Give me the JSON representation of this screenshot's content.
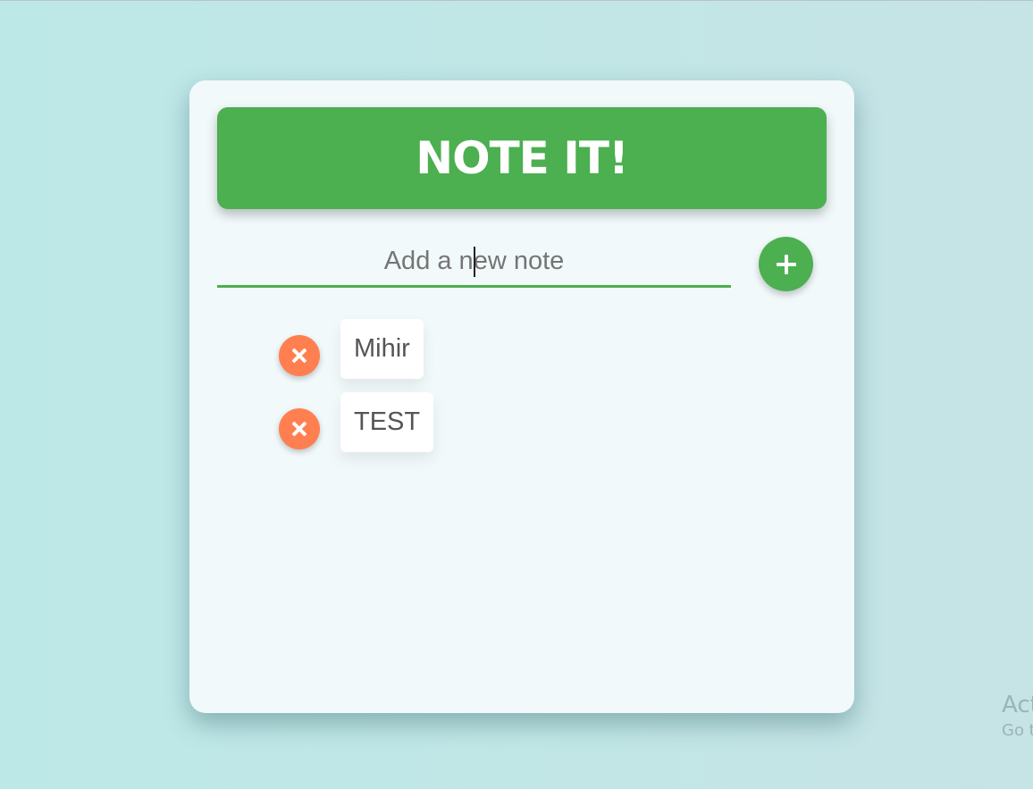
{
  "app": {
    "title": "NOTE IT!"
  },
  "input": {
    "placeholder": "Add a new note",
    "value": ""
  },
  "add_button": {
    "icon": "plus-icon"
  },
  "notes": [
    {
      "text": "Mihir",
      "delete_icon": "close-icon"
    },
    {
      "text": "TEST",
      "delete_icon": "close-icon"
    }
  ],
  "watermark": {
    "title": "Act",
    "subtitle": "Go t"
  },
  "colors": {
    "background": "#bfe7e7",
    "card": "#f1f9fb",
    "accent_green": "#4caf50",
    "delete_orange": "#ff7f50",
    "note_text": "#555555"
  }
}
